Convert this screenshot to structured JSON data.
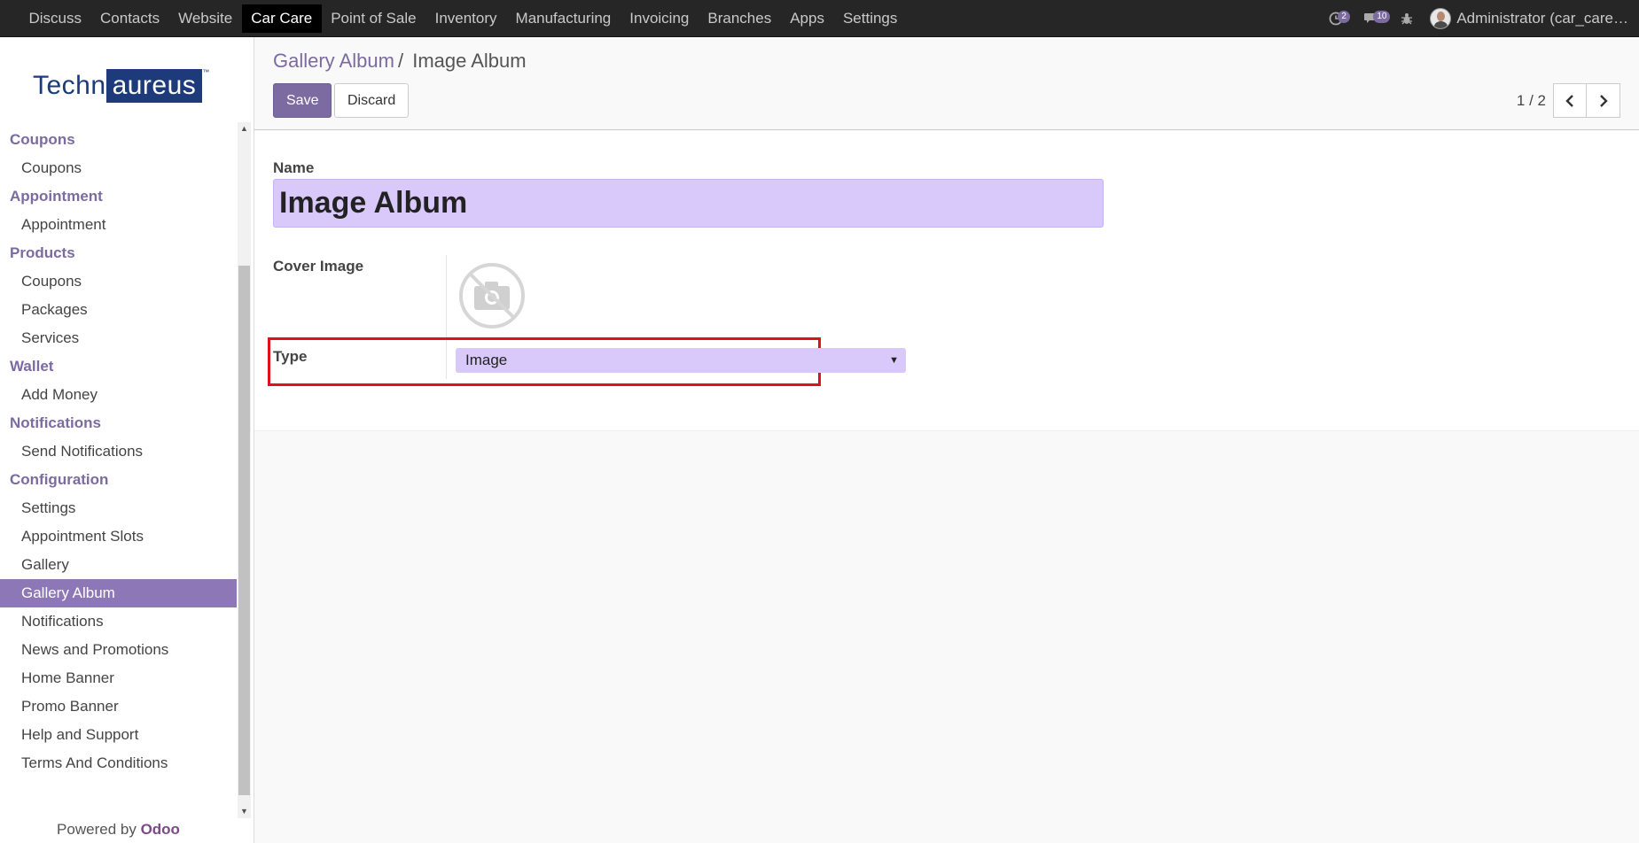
{
  "topbar": {
    "menu": [
      "Discuss",
      "Contacts",
      "Website",
      "Car Care",
      "Point of Sale",
      "Inventory",
      "Manufacturing",
      "Invoicing",
      "Branches",
      "Apps",
      "Settings"
    ],
    "active": "Car Care",
    "activity_count": "2",
    "message_count": "10",
    "user": "Administrator (car_care…",
    "icons": [
      "clock-icon",
      "chat-icon",
      "bug-icon"
    ]
  },
  "sidebar": {
    "logo_part1": "Techn",
    "logo_part2": "aureus",
    "logo_tm": "™",
    "sections": [
      {
        "title": "Coupons",
        "items": [
          "Coupons"
        ]
      },
      {
        "title": "Appointment",
        "items": [
          "Appointment"
        ]
      },
      {
        "title": "Products",
        "items": [
          "Coupons",
          "Packages",
          "Services"
        ]
      },
      {
        "title": "Wallet",
        "items": [
          "Add Money"
        ]
      },
      {
        "title": "Notifications",
        "items": [
          "Send Notifications"
        ]
      },
      {
        "title": "Configuration",
        "items": [
          "Settings",
          "Appointment Slots",
          "Gallery",
          "Gallery Album",
          "Notifications",
          "News and Promotions",
          "Home Banner",
          "Promo Banner",
          "Help and Support",
          "Terms And Conditions"
        ]
      }
    ],
    "active_item": "Gallery Album",
    "powered_prefix": "Powered by",
    "powered_brand": "Odoo"
  },
  "control": {
    "breadcrumb_parent": "Gallery Album",
    "breadcrumb_sep": "/",
    "breadcrumb_current": "Image Album",
    "save_label": "Save",
    "discard_label": "Discard",
    "pager": "1 / 2"
  },
  "form": {
    "name_label": "Name",
    "name_value": "Image Album",
    "cover_label": "Cover Image",
    "type_label": "Type",
    "type_value": "Image",
    "highlight_color": "#e0111c"
  },
  "colors": {
    "brand": "#7c6ba0",
    "input_bg": "#d8c9fa",
    "topbar": "#262626"
  }
}
